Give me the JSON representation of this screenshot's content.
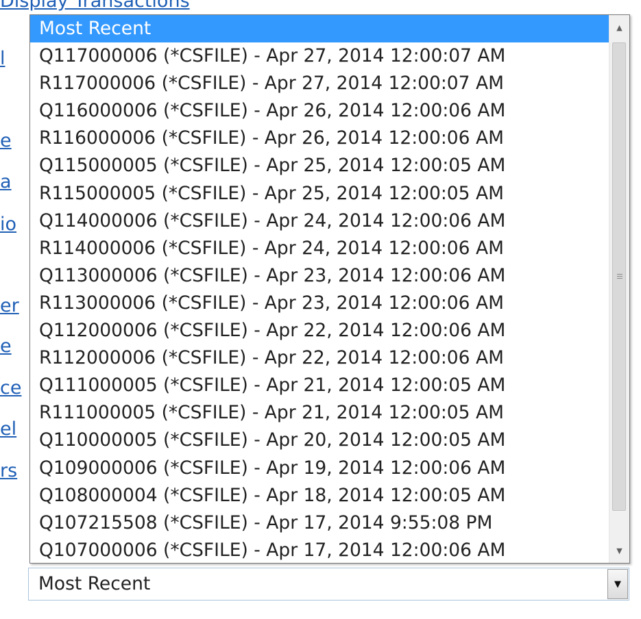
{
  "background_links": {
    "title": "Display Transactions",
    "fragments": [
      "l",
      "e",
      "a",
      "io",
      "er",
      "e",
      "ce",
      "el",
      "rs"
    ]
  },
  "dropdown": {
    "options": [
      "Most Recent",
      "Q117000006 (*CSFILE) - Apr 27, 2014 12:00:07 AM",
      "R117000006 (*CSFILE) - Apr 27, 2014 12:00:07 AM",
      "Q116000006 (*CSFILE) - Apr 26, 2014 12:00:06 AM",
      "R116000006 (*CSFILE) - Apr 26, 2014 12:00:06 AM",
      "Q115000005 (*CSFILE) - Apr 25, 2014 12:00:05 AM",
      "R115000005 (*CSFILE) - Apr 25, 2014 12:00:05 AM",
      "Q114000006 (*CSFILE) - Apr 24, 2014 12:00:06 AM",
      "R114000006 (*CSFILE) - Apr 24, 2014 12:00:06 AM",
      "Q113000006 (*CSFILE) - Apr 23, 2014 12:00:06 AM",
      "R113000006 (*CSFILE) - Apr 23, 2014 12:00:06 AM",
      "Q112000006 (*CSFILE) - Apr 22, 2014 12:00:06 AM",
      "R112000006 (*CSFILE) - Apr 22, 2014 12:00:06 AM",
      "Q111000005 (*CSFILE) - Apr 21, 2014 12:00:05 AM",
      "R111000005 (*CSFILE) - Apr 21, 2014 12:00:05 AM",
      "Q110000005 (*CSFILE) - Apr 20, 2014 12:00:05 AM",
      "Q109000006 (*CSFILE) - Apr 19, 2014 12:00:06 AM",
      "Q108000004 (*CSFILE) - Apr 18, 2014 12:00:05 AM",
      "Q107215508 (*CSFILE) - Apr 17, 2014 9:55:08 PM",
      "Q107000006 (*CSFILE) - Apr 17, 2014 12:00:06 AM"
    ],
    "highlighted_index": 0
  },
  "select": {
    "value": "Most Recent"
  },
  "icons": {
    "scroll_up": "scroll-up-arrow",
    "scroll_down": "scroll-down-arrow",
    "dropdown_arrow": "chevron-down"
  },
  "colors": {
    "highlight": "#3399ff",
    "link": "#1f5fb6"
  }
}
